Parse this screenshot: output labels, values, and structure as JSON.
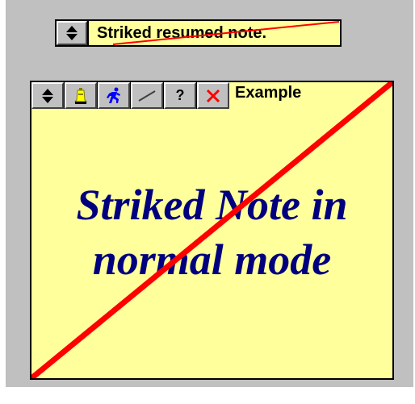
{
  "resumed_note": {
    "text": "Striked resumed note.",
    "icon": "updown-arrows-icon"
  },
  "note": {
    "title": "Example",
    "body_line1": "Striked Note in",
    "body_line2": "normal mode",
    "toolbar": [
      {
        "name": "resume-button",
        "icon": "updown-arrows-icon"
      },
      {
        "name": "alarm-button",
        "icon": "bell-icon"
      },
      {
        "name": "run-button",
        "icon": "running-man-icon"
      },
      {
        "name": "strike-button",
        "icon": "strike-line-icon"
      },
      {
        "name": "help-button",
        "icon": "question-mark-icon",
        "label": "?"
      },
      {
        "name": "close-button",
        "icon": "close-icon"
      }
    ]
  },
  "colors": {
    "background": "#c0c0c0",
    "note": "#ffff9c",
    "strike": "#ff0000",
    "body_text": "#00007f"
  }
}
